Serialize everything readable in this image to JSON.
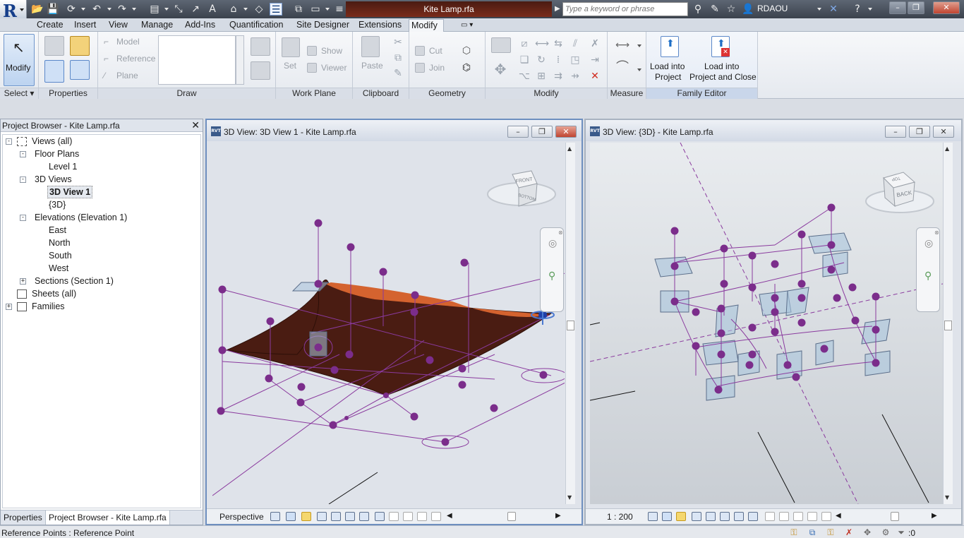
{
  "titlebar": {
    "app_letter": "R",
    "document_title": "Kite Lamp.rfa",
    "search_placeholder": "Type a keyword or phrase",
    "user": "RDAOU",
    "icons": [
      "open-icon",
      "save-icon",
      "sync-icon",
      "undo-icon",
      "redo-icon",
      "print-icon",
      "measure-icon",
      "dimension-icon",
      "text-icon",
      "3d-view-icon",
      "section-icon",
      "thin-lines-icon",
      "close-windows-icon",
      "switch-windows-icon",
      "customize-qat-icon",
      "binoculars-icon",
      "subscription-icon",
      "star-icon",
      "user-icon",
      "exchange-icon",
      "help-icon"
    ]
  },
  "tabs": [
    "Create",
    "Insert",
    "View",
    "Manage",
    "Add-Ins",
    "Quantification",
    "Site Designer",
    "Extensions",
    "Modify"
  ],
  "active_tab": "Modify",
  "ribbon": {
    "select": {
      "modify_label": "Modify",
      "panel_label": "Select"
    },
    "properties": {
      "panel_label": "Properties"
    },
    "draw": {
      "model": "Model",
      "reference": "Reference",
      "plane": "Plane",
      "panel_label": "Draw"
    },
    "work_plane": {
      "set": "Set",
      "show": "Show",
      "viewer": "Viewer",
      "panel_label": "Work Plane"
    },
    "clipboard": {
      "paste": "Paste",
      "panel_label": "Clipboard"
    },
    "geometry": {
      "cut": "Cut",
      "join": "Join",
      "panel_label": "Geometry"
    },
    "modify": {
      "panel_label": "Modify"
    },
    "measure": {
      "panel_label": "Measure"
    },
    "family_editor": {
      "load_into_project_line1": "Load into",
      "load_into_project_line2": "Project",
      "load_close_line1": "Load into",
      "load_close_line2": "Project and Close",
      "panel_label": "Family Editor"
    }
  },
  "browser": {
    "title": "Project Browser - Kite Lamp.rfa",
    "tree": [
      {
        "label": "Views (all)",
        "level": 0,
        "expander": "-"
      },
      {
        "label": "Floor Plans",
        "level": 1,
        "expander": "-"
      },
      {
        "label": "Level 1",
        "level": 2
      },
      {
        "label": "3D Views",
        "level": 1,
        "expander": "-"
      },
      {
        "label": "3D View 1",
        "level": 2,
        "selected": true
      },
      {
        "label": "{3D}",
        "level": 2
      },
      {
        "label": "Elevations (Elevation 1)",
        "level": 1,
        "expander": "-"
      },
      {
        "label": "East",
        "level": 2
      },
      {
        "label": "North",
        "level": 2
      },
      {
        "label": "South",
        "level": 2
      },
      {
        "label": "West",
        "level": 2
      },
      {
        "label": "Sections (Section 1)",
        "level": 1,
        "expander": "+"
      },
      {
        "label": "Sheets (all)",
        "level": 0
      },
      {
        "label": "Families",
        "level": 0,
        "expander": "+"
      }
    ],
    "bottom_tabs": [
      "Properties",
      "Project Browser - Kite Lamp.rfa"
    ]
  },
  "view1": {
    "title": "3D View: 3D View 1 - Kite Lamp.rfa",
    "control_label": "Perspective",
    "viewcube_faces": [
      "FRONT",
      "BOTTOM"
    ]
  },
  "view2": {
    "title": "3D View: {3D} - Kite Lamp.rfa",
    "control_label": "1 : 200",
    "viewcube_faces": [
      "BACK",
      "TOP"
    ]
  },
  "status": {
    "text": "Reference Points : Reference Point",
    "filter_count": ":0"
  },
  "colors": {
    "point": "#7b2d8b",
    "line": "#8a3a9e",
    "surface_top": "#d4632f",
    "surface_under": "#4a1c12",
    "plane_fill": "#a9c4dc",
    "accent": "#3a6fb5"
  }
}
